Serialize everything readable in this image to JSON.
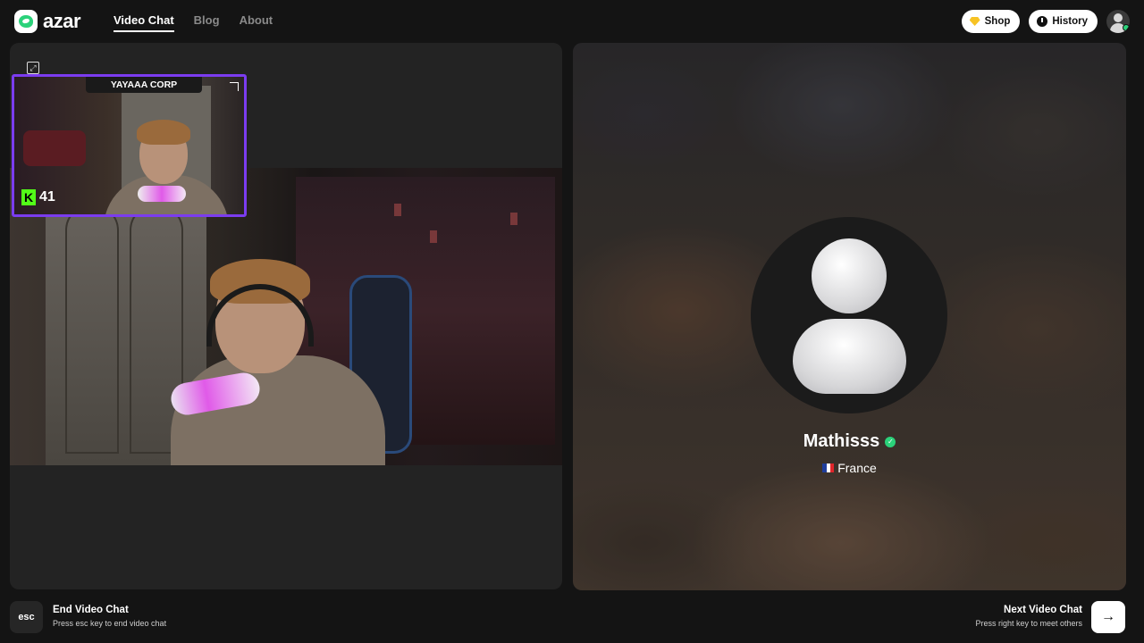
{
  "brand": {
    "name": "azar",
    "accent": "#2bd27a"
  },
  "nav": {
    "items": [
      {
        "label": "Video Chat",
        "active": true
      },
      {
        "label": "Blog",
        "active": false
      },
      {
        "label": "About",
        "active": false
      }
    ]
  },
  "header": {
    "shop_label": "Shop",
    "history_label": "History"
  },
  "self_view": {
    "overlay_banner": "YAYAAA CORP",
    "viewer_count": "41",
    "overlay_color": "#7b3cf0"
  },
  "partner": {
    "name": "Mathisss",
    "country": "France",
    "verified": true
  },
  "footer": {
    "esc_key": "esc",
    "end_label": "End Video Chat",
    "end_hint": "Press esc key to end video chat",
    "next_label": "Next Video Chat",
    "next_hint": "Press right key to meet others",
    "next_icon": "→"
  }
}
